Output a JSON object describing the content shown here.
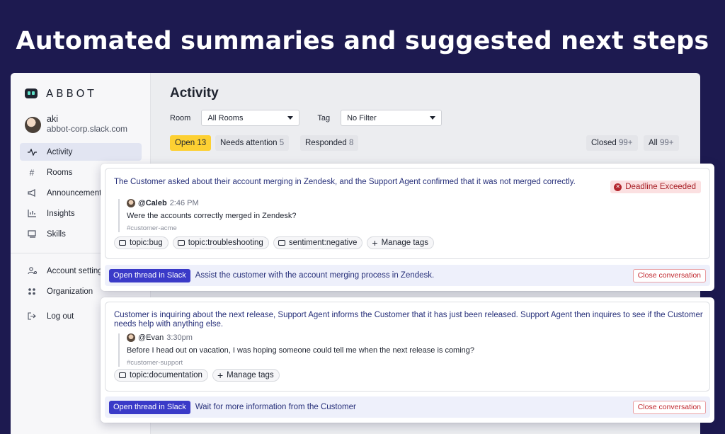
{
  "headline": "Automated summaries and suggested next steps",
  "app": {
    "logo_text": "ABBOT",
    "user": {
      "name": "aki",
      "workspace": "abbot-corp.slack.com"
    },
    "nav": {
      "primary": [
        {
          "label": "Activity",
          "icon": "pulse-icon"
        },
        {
          "label": "Rooms",
          "icon": "hash-icon"
        },
        {
          "label": "Announcements",
          "icon": "megaphone-icon"
        },
        {
          "label": "Insights",
          "icon": "chart-icon"
        },
        {
          "label": "Skills",
          "icon": "skills-icon"
        }
      ],
      "secondary": [
        {
          "label": "Account settings",
          "icon": "user-gear-icon"
        },
        {
          "label": "Organization",
          "icon": "org-icon"
        },
        {
          "label": "Log out",
          "icon": "logout-icon"
        }
      ]
    }
  },
  "page": {
    "title": "Activity",
    "filters": {
      "room_label": "Room",
      "room_value": "All Rooms",
      "tag_label": "Tag",
      "tag_value": "No Filter"
    },
    "tabs": [
      {
        "label": "Open",
        "count": "13",
        "active": true
      },
      {
        "label": "Needs attention",
        "count": "5"
      },
      {
        "label": "Responded",
        "count": "8"
      },
      {
        "label": "Closed",
        "count": "99+"
      },
      {
        "label": "All",
        "count": "99+"
      }
    ]
  },
  "conversations": [
    {
      "summary": "The Customer asked about their account merging in Zendesk, and the Support Agent confirmed that it was not merged correctly.",
      "badge": "Deadline Exceeded",
      "message": {
        "user": "@Caleb",
        "time": "2:46 PM",
        "text": "Were the accounts correctly merged in Zendesk?",
        "channel": "#customer-acme"
      },
      "tags": [
        "topic:bug",
        "topic:troubleshooting",
        "sentiment:negative"
      ],
      "manage_tags_label": "Manage tags",
      "open_thread_label": "Open thread in Slack",
      "next_step": "Assist the customer with the account merging process in Zendesk.",
      "close_label": "Close conversation"
    },
    {
      "summary": "Customer is inquiring about the next release, Support Agent informs the Customer that it has just been released. Support Agent then inquires to see if the Customer needs help with anything else.",
      "message": {
        "user": "@Evan",
        "time": "3:30pm",
        "text": "Before I head out on vacation, I was hoping someone could tell me when the next release is coming?",
        "channel": "#customer-support"
      },
      "tags": [
        "topic:documentation"
      ],
      "manage_tags_label": "Manage tags",
      "open_thread_label": "Open thread in Slack",
      "next_step": "Wait for more information from the Customer",
      "close_label": "Close conversation"
    }
  ],
  "colors": {
    "background": "#1d1a50",
    "accent": "#3a3ac8",
    "active_tab": "#fdd032",
    "summary_text": "#27307a",
    "danger": "#c0262d"
  }
}
